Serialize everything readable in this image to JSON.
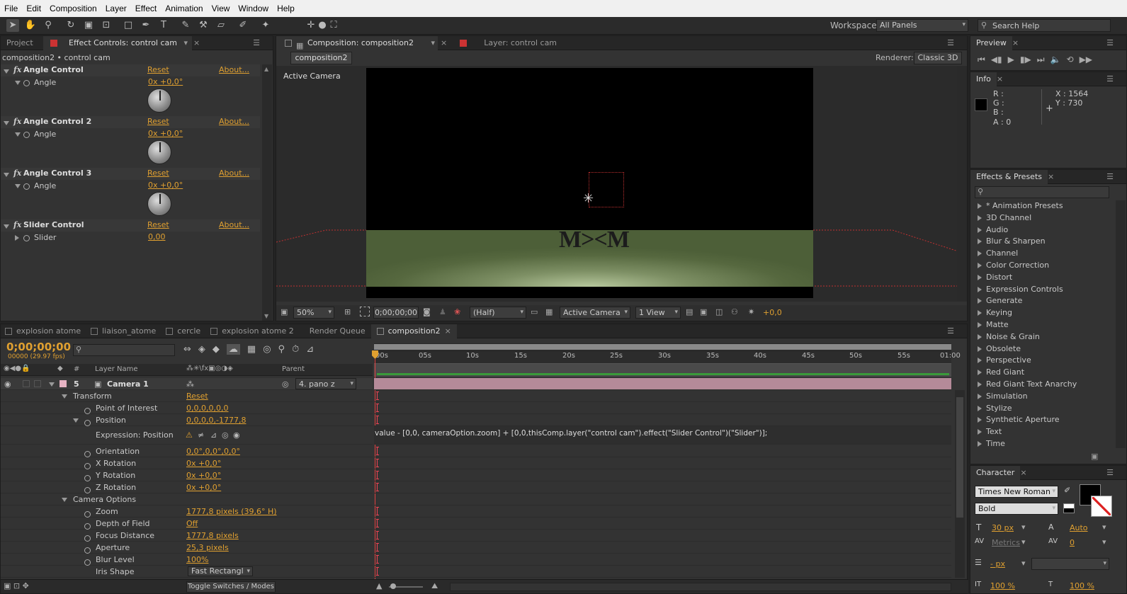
{
  "menu": [
    "File",
    "Edit",
    "Composition",
    "Layer",
    "Effect",
    "Animation",
    "View",
    "Window",
    "Help"
  ],
  "toolbar": {
    "workspace_label": "Workspace:",
    "workspace_value": "All Panels",
    "search_placeholder": "Search Help"
  },
  "project_tab": "Project",
  "effect_controls": {
    "tab": "Effect Controls: control cam",
    "breadcrumb": "composition2 • control cam",
    "effects": [
      {
        "name": "Angle Control",
        "reset": "Reset",
        "about": "About...",
        "param": "Angle",
        "value": "0x +0,0°"
      },
      {
        "name": "Angle Control 2",
        "reset": "Reset",
        "about": "About...",
        "param": "Angle",
        "value": "0x +0,0°"
      },
      {
        "name": "Angle Control 3",
        "reset": "Reset",
        "about": "About...",
        "param": "Angle",
        "value": "0x +0,0°"
      },
      {
        "name": "Slider Control",
        "reset": "Reset",
        "about": "About...",
        "param": "Slider",
        "value": "0,00"
      }
    ]
  },
  "comp_viewer": {
    "tab": "Composition: composition2",
    "layer_tab": "Layer: control cam",
    "sub_tab": "composition2",
    "renderer_label": "Renderer:",
    "renderer_value": "Classic 3D",
    "active_camera": "Active Camera",
    "scene_text": "M><M",
    "bottom": {
      "zoom": "50%",
      "timecode": "0;00;00;00",
      "resolution": "(Half)",
      "view": "Active Camera",
      "layout": "1 View",
      "exposure": "+0,0"
    }
  },
  "preview": {
    "tab": "Preview"
  },
  "info": {
    "tab": "Info",
    "r": "R :",
    "g": "G :",
    "b": "B :",
    "a": "A : 0",
    "x": "X : 1564",
    "y": "Y : 730"
  },
  "effects_presets": {
    "tab": "Effects & Presets",
    "items": [
      "* Animation Presets",
      "3D Channel",
      "Audio",
      "Blur & Sharpen",
      "Channel",
      "Color Correction",
      "Distort",
      "Expression Controls",
      "Generate",
      "Keying",
      "Matte",
      "Noise & Grain",
      "Obsolete",
      "Perspective",
      "Red Giant",
      "Red Giant Text Anarchy",
      "Simulation",
      "Stylize",
      "Synthetic Aperture",
      "Text",
      "Time"
    ]
  },
  "character": {
    "tab": "Character",
    "font": "Times New Roman",
    "style": "Bold",
    "size": "30 px",
    "leading": "Auto",
    "kerning": "Metrics",
    "tracking": "0",
    "stroke": "- px",
    "h_scale": "100 %",
    "v_scale": "100 %"
  },
  "timeline": {
    "tabs": [
      "explosion atome",
      "liaison_atome",
      "cercle",
      "explosion atome 2",
      "Render Queue",
      "composition2"
    ],
    "timecode": "0;00;00;00",
    "fps": "00000 (29.97 fps)",
    "col_layer_name": "Layer Name",
    "col_parent": "Parent",
    "col_num": "#",
    "ticks": [
      "00s",
      "05s",
      "10s",
      "15s",
      "20s",
      "25s",
      "30s",
      "35s",
      "40s",
      "45s",
      "50s",
      "55s",
      "01:00"
    ],
    "layer": {
      "num": "5",
      "name": "Camera 1",
      "parent": "4. pano z"
    },
    "rows": [
      {
        "label": "Transform",
        "value": "Reset"
      },
      {
        "label": "Point of Interest",
        "value": "0,0,0,0,0,0"
      },
      {
        "label": "Position",
        "value": "0,0,0,0,-1777,8"
      },
      {
        "label": "Expression: Position",
        "value": ""
      },
      {
        "label": "Orientation",
        "value": "0,0°,0,0°,0,0°"
      },
      {
        "label": "X Rotation",
        "value": "0x +0,0°"
      },
      {
        "label": "Y Rotation",
        "value": "0x +0,0°"
      },
      {
        "label": "Z Rotation",
        "value": "0x +0,0°"
      },
      {
        "label": "Camera Options",
        "value": ""
      },
      {
        "label": "Zoom",
        "value": "1777,8 pixels (39,6° H)"
      },
      {
        "label": "Depth of Field",
        "value": "Off"
      },
      {
        "label": "Focus Distance",
        "value": "1777,8 pixels"
      },
      {
        "label": "Aperture",
        "value": "25,3 pixels"
      },
      {
        "label": "Blur Level",
        "value": "100%"
      },
      {
        "label": "Iris Shape",
        "value": "Fast Rectangl"
      }
    ],
    "expression": "value - [0,0, cameraOption.zoom] + [0,0,thisComp.layer(\"control  cam\").effect(\"Slider Control\")(\"Slider\")];",
    "toggle": "Toggle Switches / Modes"
  }
}
